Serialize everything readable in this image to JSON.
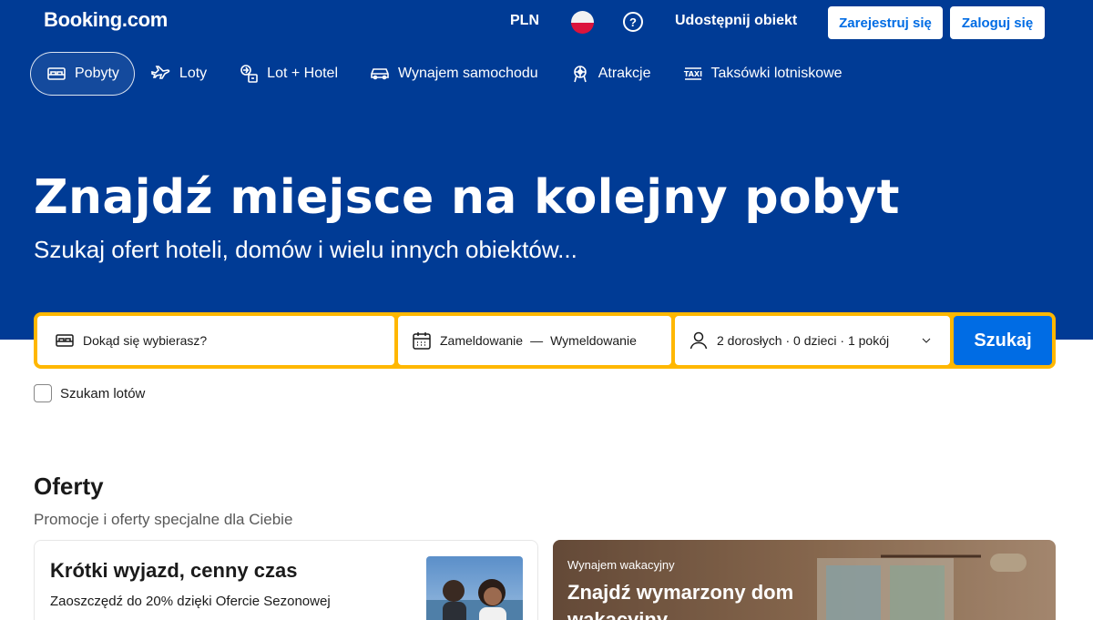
{
  "header": {
    "logo": "Booking.com",
    "currency": "PLN",
    "help_glyph": "?",
    "list_property": "Udostępnij obiekt",
    "register": "Zarejestruj się",
    "login": "Zaloguj się"
  },
  "nav": {
    "tabs": [
      {
        "label": "Pobyty",
        "icon": "bed-icon",
        "active": true
      },
      {
        "label": "Loty",
        "icon": "plane-icon"
      },
      {
        "label": "Lot + Hotel",
        "icon": "flight-hotel-icon"
      },
      {
        "label": "Wynajem samochodu",
        "icon": "car-icon"
      },
      {
        "label": "Atrakcje",
        "icon": "attractions-icon"
      },
      {
        "label": "Taksówki lotniskowe",
        "icon": "taxi-icon"
      }
    ]
  },
  "hero": {
    "title": "Znajdź miejsce na kolejny pobyt",
    "subtitle": "Szukaj ofert hoteli, domów i wielu innych obiektów..."
  },
  "search": {
    "destination_placeholder": "Dokąd się wybierasz?",
    "checkin": "Zameldowanie",
    "dash": "—",
    "checkout": "Wymeldowanie",
    "guests": "2 dorosłych · 0 dzieci · 1 pokój",
    "button": "Szukaj",
    "flights_checkbox": "Szukam lotów"
  },
  "offers": {
    "title": "Oferty",
    "subtitle": "Promocje i oferty specjalne dla Ciebie",
    "card1": {
      "title": "Krótki wyjazd, cenny czas",
      "description": "Zaoszczędź do 20% dzięki Ofercie Sezonowej"
    },
    "card2": {
      "label": "Wynajem wakacyjny",
      "title": "Znajdź wymarzony dom",
      "title_cont": "wakacyjny"
    }
  },
  "colors": {
    "brand_blue": "#003b95",
    "action_blue": "#006ce4",
    "search_border": "#ffb700"
  }
}
